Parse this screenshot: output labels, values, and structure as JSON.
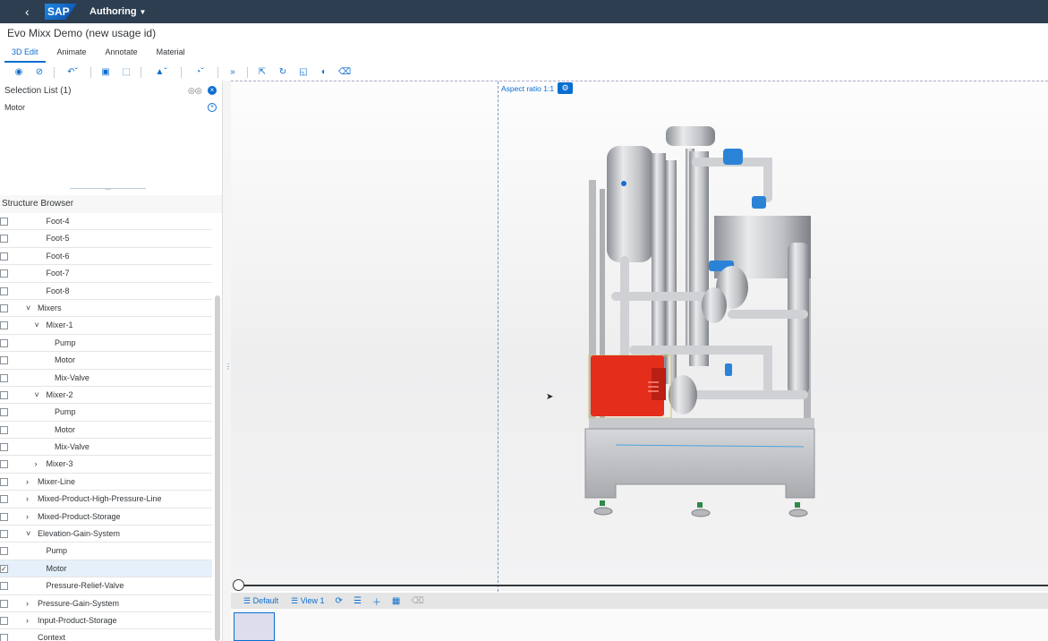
{
  "shell": {
    "back_icon": "back-icon",
    "logo": "SAP",
    "app_menu": "Authoring"
  },
  "document": {
    "title": "Evo Mixx Demo (new usage id)"
  },
  "tabs": [
    {
      "label": "3D Edit",
      "active": true
    },
    {
      "label": "Animate"
    },
    {
      "label": "Annotate"
    },
    {
      "label": "Material"
    }
  ],
  "selection_list": {
    "title": "Selection List (1)",
    "items": [
      "Motor"
    ]
  },
  "structure_browser": {
    "title": "Structure Browser",
    "rows": [
      {
        "label": "Foot-4",
        "level": 2,
        "checked": false
      },
      {
        "label": "Foot-5",
        "level": 2,
        "checked": false
      },
      {
        "label": "Foot-6",
        "level": 2,
        "checked": false
      },
      {
        "label": "Foot-7",
        "level": 2,
        "checked": false
      },
      {
        "label": "Foot-8",
        "level": 2,
        "checked": false
      },
      {
        "label": "Mixers",
        "level": 1,
        "expander": "open",
        "checked": false
      },
      {
        "label": "Mixer-1",
        "level": 2,
        "expander": "open",
        "checked": false
      },
      {
        "label": "Pump",
        "level": 3,
        "checked": false
      },
      {
        "label": "Motor",
        "level": 3,
        "checked": false
      },
      {
        "label": "Mix-Valve",
        "level": 3,
        "checked": false
      },
      {
        "label": "Mixer-2",
        "level": 2,
        "expander": "open",
        "checked": false
      },
      {
        "label": "Pump",
        "level": 3,
        "checked": false
      },
      {
        "label": "Motor",
        "level": 3,
        "checked": false
      },
      {
        "label": "Mix-Valve",
        "level": 3,
        "checked": false
      },
      {
        "label": "Mixer-3",
        "level": 2,
        "expander": "closed",
        "checked": false
      },
      {
        "label": "Mixer-Line",
        "level": 1,
        "expander": "closed",
        "checked": false
      },
      {
        "label": "Mixed-Product-High-Pressure-Line",
        "level": 1,
        "expander": "closed",
        "checked": false
      },
      {
        "label": "Mixed-Product-Storage",
        "level": 1,
        "expander": "closed",
        "checked": false
      },
      {
        "label": "Elevation-Gain-System",
        "level": 1,
        "expander": "open",
        "checked": false
      },
      {
        "label": "Pump",
        "level": 2,
        "checked": false
      },
      {
        "label": "Motor",
        "level": 2,
        "checked": true,
        "selected": true
      },
      {
        "label": "Pressure-Relief-Valve",
        "level": 2,
        "checked": false
      },
      {
        "label": "Pressure-Gain-System",
        "level": 1,
        "expander": "closed",
        "checked": false
      },
      {
        "label": "Input-Product-Storage",
        "level": 1,
        "expander": "closed",
        "checked": false
      },
      {
        "label": "Context",
        "level": 1,
        "checked": false
      }
    ]
  },
  "viewport": {
    "aspect_ratio_label": "Aspect ratio 1:1",
    "highlight_color": "#e52d1c",
    "accent": "#0a6ed1"
  },
  "steps": {
    "procedure": "Default",
    "view": "View 1"
  }
}
